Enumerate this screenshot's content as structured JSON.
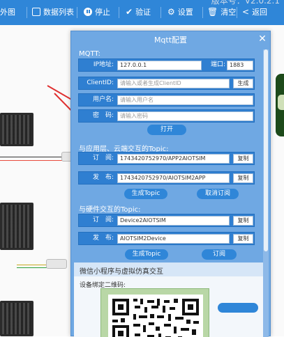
{
  "toolbar": {
    "partial_left": "外图",
    "items": [
      {
        "label": "数据列表",
        "icon": "list-icon"
      },
      {
        "label": "停止",
        "icon": "pause-icon"
      },
      {
        "label": "验证",
        "icon": "check-icon"
      },
      {
        "label": "设置",
        "icon": "gear-icon"
      },
      {
        "label": "清空",
        "icon": "trash-icon"
      },
      {
        "label": "返回",
        "icon": "back-icon"
      }
    ],
    "version": "版本号：V2.0.2.1"
  },
  "dialog": {
    "title": "Mqtt配置",
    "close_glyph": "✕",
    "mqtt_section": "MQTT:",
    "ip_label": "IP地址:",
    "ip_value": "127.0.0.1",
    "port_label": "端口:",
    "port_value": "1883",
    "clientid_label": "ClientID:",
    "clientid_placeholder": "请输入或者生成ClientID",
    "generate_label": "生成",
    "username_label": "用户名:",
    "username_placeholder": "请输入用户名",
    "password_label": "密　码:",
    "password_placeholder": "请输入密码",
    "open_button": "打开",
    "app_section": "与应用层、云端交互的Topic:",
    "sub_label": "订　阅:",
    "app_sub_value": "1743420752970/APP2AIOTSIM",
    "pub_label": "发　布:",
    "app_pub_value": "1743420752970/AIOTSIM2APP",
    "copy_label": "复制",
    "gen_topic_button": "生成Topic",
    "unsubscribe_button": "取消订阅",
    "hw_section": "与硬件交互的Topic:",
    "hw_sub_value": "Device2AIOTSIM",
    "hw_pub_value": "AIOTSIM2Device",
    "subscribe_button": "订阅",
    "miniapp_title": "微信小程序与虚拟仿真交互",
    "qr_label": "设备绑定二维码:"
  }
}
